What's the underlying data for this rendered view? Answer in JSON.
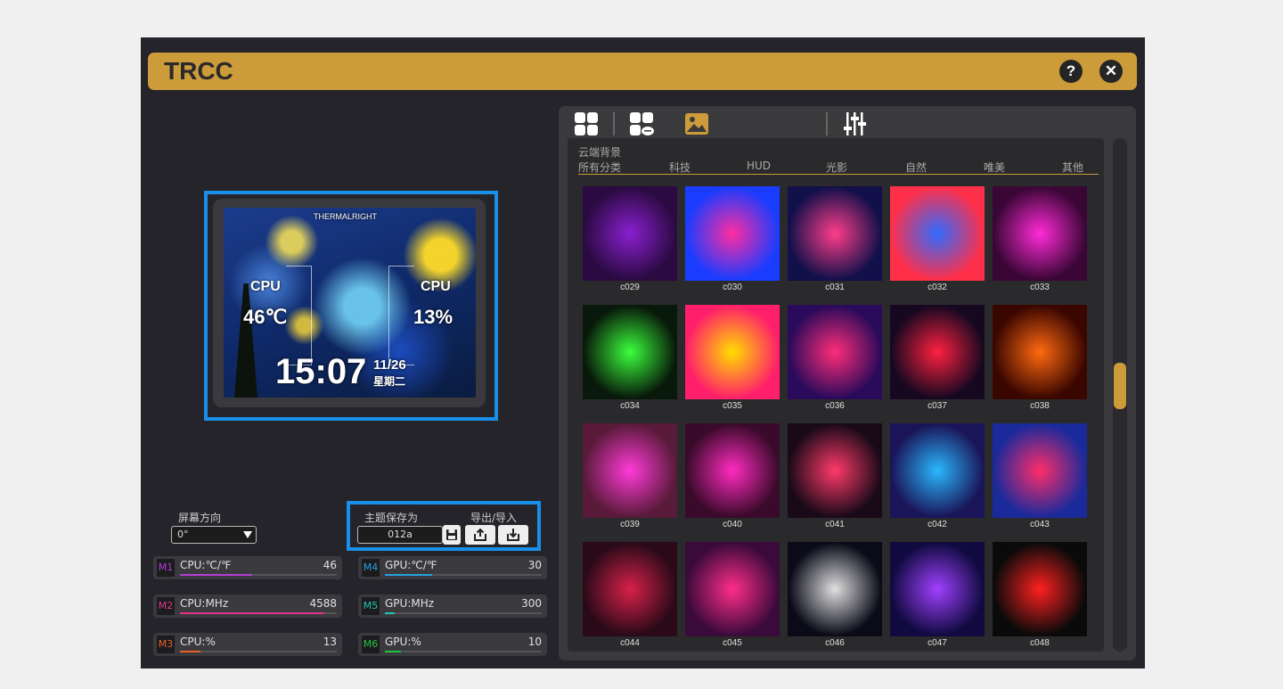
{
  "app": {
    "title": "TRCC",
    "help_label": "?",
    "close_label": "✕"
  },
  "preview": {
    "brand": "THERMALRIGHT",
    "cpu_left_label": "CPU",
    "cpu_left_value": "46℃",
    "cpu_right_label": "CPU",
    "cpu_right_value": "13%",
    "time": "15:07",
    "date": "11/26",
    "weekday": "星期二"
  },
  "orientation": {
    "label": "屏幕方向",
    "value": "0°"
  },
  "theme": {
    "save_label": "主题保存为",
    "export_import_label": "导出/导入",
    "name_value": "012a",
    "icons": [
      "save-icon",
      "export-icon",
      "import-icon"
    ]
  },
  "metrics": [
    {
      "badge": "M1",
      "label": "CPU:℃/℉",
      "value": "46",
      "fill": 0.46,
      "color": "#b43cd8"
    },
    {
      "badge": "M2",
      "label": "CPU:MHz",
      "value": "4588",
      "fill": 0.92,
      "color": "#e0338a"
    },
    {
      "badge": "M3",
      "label": "CPU:%",
      "value": "13",
      "fill": 0.13,
      "color": "#e8602a"
    },
    {
      "badge": "M4",
      "label": "GPU:℃/℉",
      "value": "30",
      "fill": 0.3,
      "color": "#24a2e0"
    },
    {
      "badge": "M5",
      "label": "GPU:MHz",
      "value": "300",
      "fill": 0.06,
      "color": "#1ec4b4"
    },
    {
      "badge": "M6",
      "label": "GPU:%",
      "value": "10",
      "fill": 0.1,
      "color": "#22c244"
    }
  ],
  "gallery": {
    "section_title": "云端背景",
    "categories": [
      "所有分类",
      "科技",
      "HUD",
      "光影",
      "自然",
      "唯美",
      "其他"
    ],
    "tab_icons": [
      "grid-icon",
      "cloud-grid-icon",
      "image-icon",
      "sliders-icon"
    ],
    "items": [
      {
        "label": "c029",
        "c1": "#8a1fd0",
        "c2": "#2a0a40"
      },
      {
        "label": "c030",
        "c1": "#ff2da0",
        "c2": "#1a3cff"
      },
      {
        "label": "c031",
        "c1": "#ff3d8a",
        "c2": "#12104a"
      },
      {
        "label": "c032",
        "c1": "#2f6bff",
        "c2": "#ff2f4a"
      },
      {
        "label": "c033",
        "c1": "#ff2bd6",
        "c2": "#3a0636"
      },
      {
        "label": "c034",
        "c1": "#3cff3c",
        "c2": "#08180a"
      },
      {
        "label": "c035",
        "c1": "#ffde00",
        "c2": "#ff1f6a"
      },
      {
        "label": "c036",
        "c1": "#ff2d7a",
        "c2": "#2a0a5a"
      },
      {
        "label": "c037",
        "c1": "#ff2040",
        "c2": "#160820"
      },
      {
        "label": "c038",
        "c1": "#ff6a10",
        "c2": "#3a0600"
      },
      {
        "label": "c039",
        "c1": "#ff3ad8",
        "c2": "#5a1a3a"
      },
      {
        "label": "c040",
        "c1": "#ff2bc0",
        "c2": "#3a0a2a"
      },
      {
        "label": "c041",
        "c1": "#ff3a6a",
        "c2": "#1a0a18"
      },
      {
        "label": "c042",
        "c1": "#2ab8ff",
        "c2": "#1a1458"
      },
      {
        "label": "c043",
        "c1": "#ff2d6a",
        "c2": "#1a2a9a"
      },
      {
        "label": "c044",
        "c1": "#d8204a",
        "c2": "#2a0a18"
      },
      {
        "label": "c045",
        "c1": "#ff2d8a",
        "c2": "#3a0a3a"
      },
      {
        "label": "c046",
        "c1": "#e0e0e0",
        "c2": "#0a0a18"
      },
      {
        "label": "c047",
        "c1": "#a040ff",
        "c2": "#100a40"
      },
      {
        "label": "c048",
        "c1": "#ff2020",
        "c2": "#0a0a0a"
      }
    ]
  }
}
